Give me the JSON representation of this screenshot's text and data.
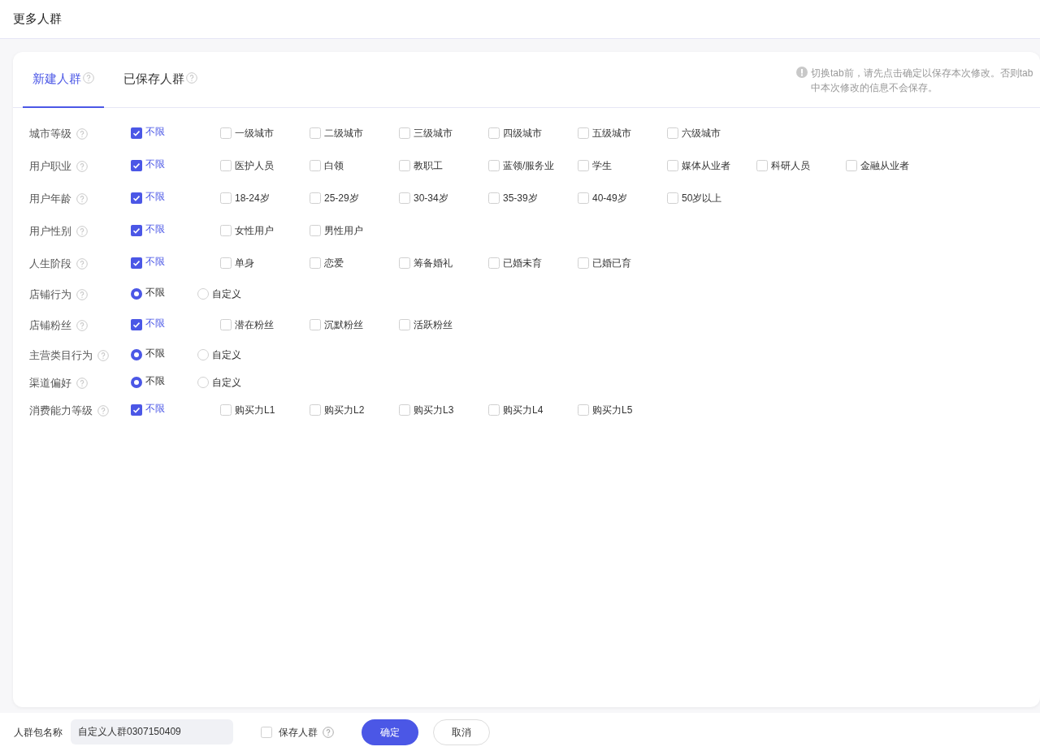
{
  "page_title": "更多人群",
  "tabs": [
    {
      "label": "新建人群",
      "selected": true
    },
    {
      "label": "已保存人群",
      "selected": false
    }
  ],
  "notice": "切换tab前，请先点击确定以保存本次修改。否则tab中本次修改的信息不会保存。",
  "filters": [
    {
      "label": "城市等级",
      "kind": "checkbox",
      "options": [
        {
          "label": "不限",
          "checked": true
        },
        {
          "label": "一级城市",
          "checked": false
        },
        {
          "label": "二级城市",
          "checked": false
        },
        {
          "label": "三级城市",
          "checked": false
        },
        {
          "label": "四级城市",
          "checked": false
        },
        {
          "label": "五级城市",
          "checked": false
        },
        {
          "label": "六级城市",
          "checked": false
        }
      ]
    },
    {
      "label": "用户职业",
      "kind": "checkbox",
      "options": [
        {
          "label": "不限",
          "checked": true
        },
        {
          "label": "医护人员",
          "checked": false
        },
        {
          "label": "白领",
          "checked": false
        },
        {
          "label": "教职工",
          "checked": false
        },
        {
          "label": "蓝领/服务业",
          "checked": false
        },
        {
          "label": "学生",
          "checked": false
        },
        {
          "label": "媒体从业者",
          "checked": false
        },
        {
          "label": "科研人员",
          "checked": false
        },
        {
          "label": "金融从业者",
          "checked": false
        }
      ]
    },
    {
      "label": "用户年龄",
      "kind": "checkbox",
      "options": [
        {
          "label": "不限",
          "checked": true
        },
        {
          "label": "18-24岁",
          "checked": false
        },
        {
          "label": "25-29岁",
          "checked": false
        },
        {
          "label": "30-34岁",
          "checked": false
        },
        {
          "label": "35-39岁",
          "checked": false
        },
        {
          "label": "40-49岁",
          "checked": false
        },
        {
          "label": "50岁以上",
          "checked": false
        }
      ]
    },
    {
      "label": "用户性别",
      "kind": "checkbox",
      "options": [
        {
          "label": "不限",
          "checked": true
        },
        {
          "label": "女性用户",
          "checked": false
        },
        {
          "label": "男性用户",
          "checked": false
        }
      ]
    },
    {
      "label": "人生阶段",
      "kind": "checkbox",
      "options": [
        {
          "label": "不限",
          "checked": true
        },
        {
          "label": "单身",
          "checked": false
        },
        {
          "label": "恋爱",
          "checked": false
        },
        {
          "label": "筹备婚礼",
          "checked": false
        },
        {
          "label": "已婚未育",
          "checked": false
        },
        {
          "label": "已婚已育",
          "checked": false
        }
      ]
    },
    {
      "label": "店铺行为",
      "kind": "radio",
      "options": [
        {
          "label": "不限",
          "selected": true
        },
        {
          "label": "自定义",
          "selected": false
        }
      ]
    },
    {
      "label": "店铺粉丝",
      "kind": "checkbox",
      "options": [
        {
          "label": "不限",
          "checked": true
        },
        {
          "label": "潜在粉丝",
          "checked": false
        },
        {
          "label": "沉默粉丝",
          "checked": false
        },
        {
          "label": "活跃粉丝",
          "checked": false
        }
      ]
    },
    {
      "label": "主营类目行为",
      "kind": "radio",
      "options": [
        {
          "label": "不限",
          "selected": true
        },
        {
          "label": "自定义",
          "selected": false
        }
      ]
    },
    {
      "label": "渠道偏好",
      "kind": "radio",
      "options": [
        {
          "label": "不限",
          "selected": true
        },
        {
          "label": "自定义",
          "selected": false
        }
      ]
    },
    {
      "label": "消费能力等级",
      "kind": "checkbox",
      "options": [
        {
          "label": "不限",
          "checked": true
        },
        {
          "label": "购买力L1",
          "checked": false
        },
        {
          "label": "购买力L2",
          "checked": false
        },
        {
          "label": "购买力L3",
          "checked": false
        },
        {
          "label": "购买力L4",
          "checked": false
        },
        {
          "label": "购买力L5",
          "checked": false
        }
      ]
    }
  ],
  "footer": {
    "name_label": "人群包名称",
    "name_value": "自定义人群0307150409",
    "save_checkbox": {
      "label": "保存人群",
      "checked": false
    },
    "buttons": [
      {
        "label": "确定",
        "kind": "primary"
      },
      {
        "label": "取消",
        "kind": "default"
      }
    ]
  }
}
